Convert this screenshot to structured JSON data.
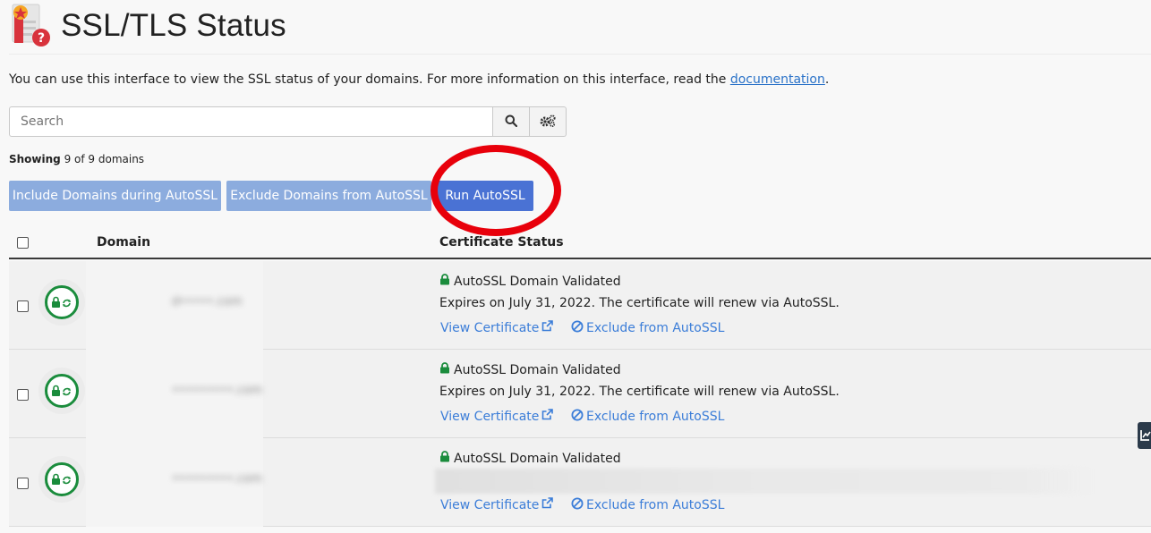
{
  "header": {
    "title": "SSL/TLS Status",
    "icon": "ssl-certificate-question-icon"
  },
  "intro": {
    "text_before": "You can use this interface to view the SSL status of your domains. For more information on this interface, read the ",
    "link_label": "documentation",
    "text_after": "."
  },
  "search": {
    "placeholder": "Search",
    "search_icon": "search-icon",
    "settings_icon": "cogs-icon"
  },
  "showing": {
    "label": "Showing",
    "text": " 9 of 9 domains"
  },
  "actions": {
    "include_label": "Include Domains during AutoSSL",
    "exclude_label": "Exclude Domains from AutoSSL",
    "run_label": "Run AutoSSL"
  },
  "table": {
    "columns": [
      "Domain",
      "Certificate Status"
    ],
    "rows": [
      {
        "domain": "d•••••.com",
        "status": "AutoSSL Domain Validated",
        "expires": "Expires on July 31, 2022. The certificate will renew via AutoSSL.",
        "view_label": "View Certificate",
        "exclude_label": "Exclude from AutoSSL"
      },
      {
        "domain": "•••••••••.com",
        "status": "AutoSSL Domain Validated",
        "expires": "Expires on July 31, 2022. The certificate will renew via AutoSSL.",
        "view_label": "View Certificate",
        "exclude_label": "Exclude from AutoSSL"
      },
      {
        "domain": "•••••••••.com",
        "status": "AutoSSL Domain Validated",
        "expires": "",
        "view_label": "View Certificate",
        "exclude_label": "Exclude from AutoSSL"
      }
    ]
  },
  "colors": {
    "accent_blue": "#4a72d4",
    "light_blue_button": "#8cacde",
    "link_blue": "#3b7dd8",
    "validated_green": "#1a8c3c",
    "annotation_red": "#e8000b"
  }
}
